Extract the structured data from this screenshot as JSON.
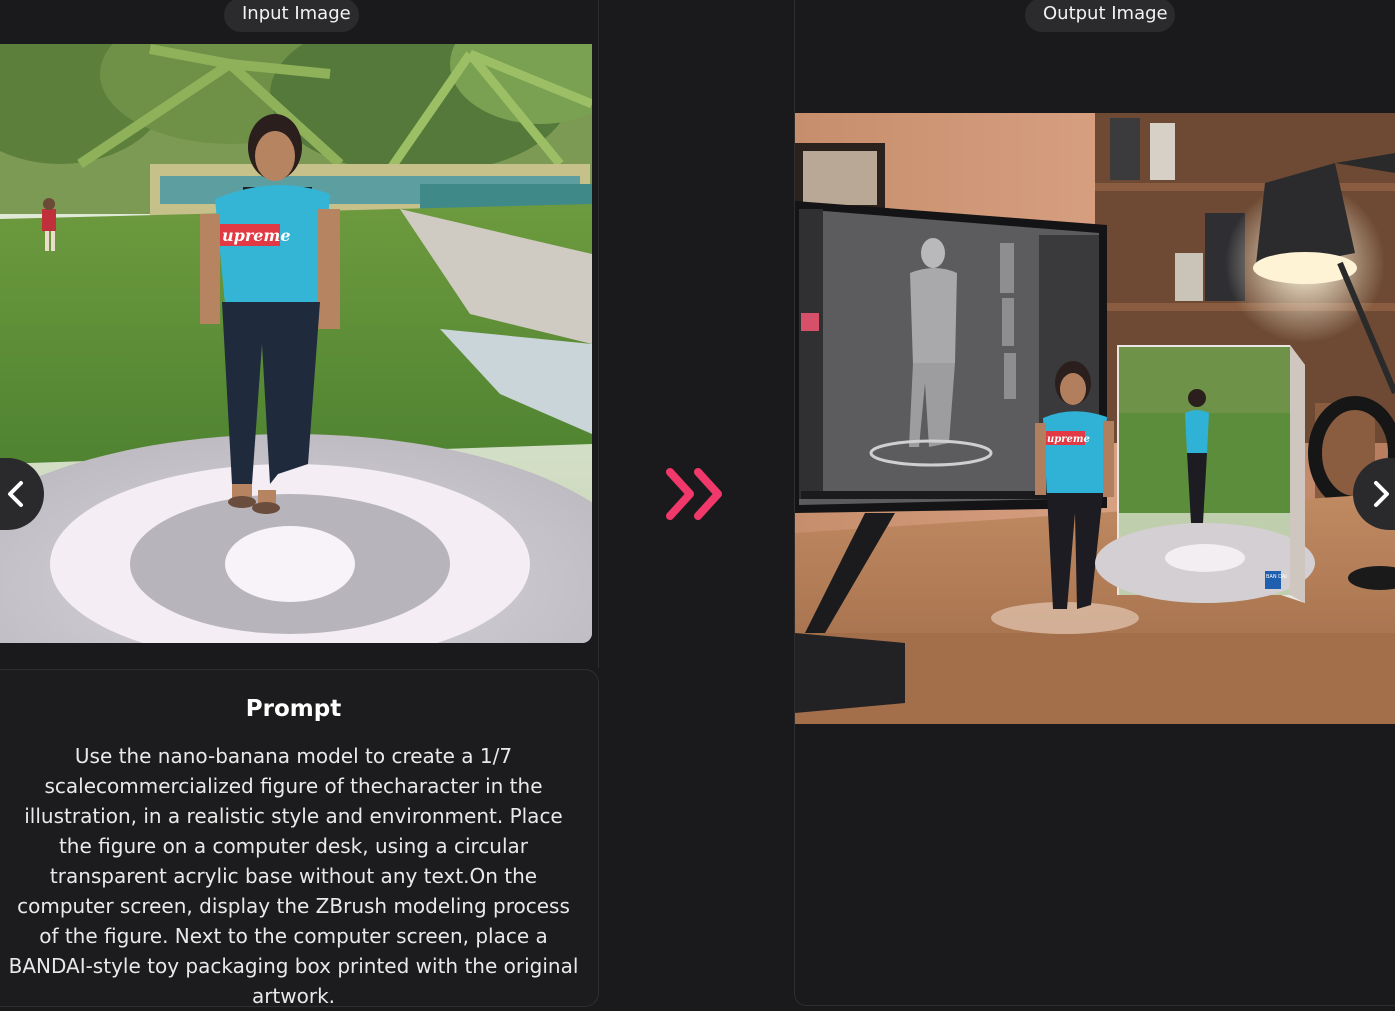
{
  "labels": {
    "input": "Input Image",
    "output": "Output Image"
  },
  "prompt": {
    "title": "Prompt",
    "text": "Use the nano-banana model to create a 1/7 scalecommercialized figure of thecharacter in the illustration, in a realistic style and environment. Place the figure on a computer desk, using a circular transparent acrylic base without any text.On the computer screen, display the ZBrush modeling process of the figure. Next to the computer screen, place a BANDAI-style toy packaging box printed with the original artwork."
  },
  "input_image": {
    "shirt_text": "upreme"
  },
  "output_image": {
    "figure_shirt_text": "upreme",
    "box_brand": "BAN DAI"
  },
  "icons": {
    "prev": "chevron-left-icon",
    "next": "chevron-right-icon",
    "transform": "double-chevron-right-icon"
  },
  "colors": {
    "accent": "#f0386b",
    "background": "#1a1a1c",
    "pill": "#2b2b2e"
  }
}
